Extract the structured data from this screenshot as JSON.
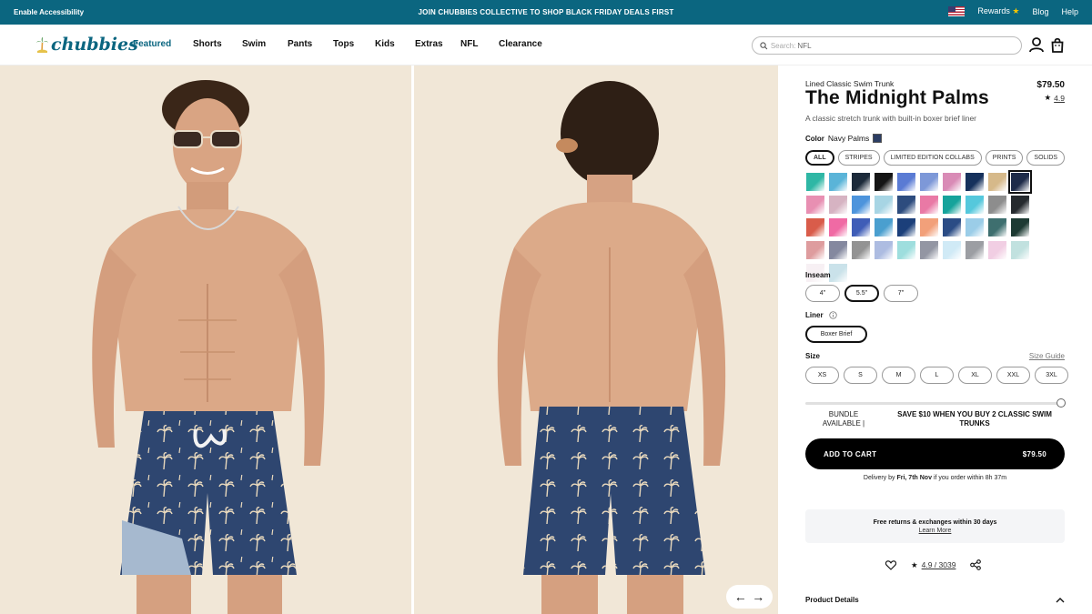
{
  "announcement": {
    "accessibility": "Enable Accessibility",
    "promo": "JOIN CHUBBIES COLLECTIVE TO SHOP BLACK FRIDAY DEALS FIRST",
    "rewards": "Rewards",
    "rewards_icon": "star-icon",
    "blog": "Blog",
    "help": "Help",
    "bg_color": "#0b6680"
  },
  "header": {
    "logo_text": "chubbies",
    "nav": [
      "Featured",
      "Shorts",
      "Swim",
      "Pants",
      "Tops",
      "Kids",
      "Extras",
      "NFL",
      "Clearance"
    ],
    "active_nav": "Featured",
    "search_label": "Search:",
    "search_value": "NFL",
    "icons": [
      "search-icon",
      "account-icon",
      "cart-icon"
    ]
  },
  "gallery": {
    "icons": [
      "arrow-left-icon",
      "arrow-right-icon"
    ],
    "prev": "←",
    "next": "→"
  },
  "product": {
    "subtitle": "Lined Classic Swim Trunk",
    "title": "The Midnight Palms",
    "price": "$79.50",
    "rating": "4.9",
    "description": "A classic stretch trunk with built-in boxer brief liner",
    "color_label": "Color",
    "color_value": "Navy Palms",
    "filters": [
      "ALL",
      "STRIPES",
      "LIMITED EDITION COLLABS",
      "PRINTS",
      "SOLIDS"
    ],
    "selected_filter": "ALL",
    "inseam_label": "Inseam",
    "inseams": [
      "4\"",
      "5.5\"",
      "7\""
    ],
    "selected_inseam": "5.5\"",
    "liner_label": "Liner",
    "liners": [
      "Boxer Brief"
    ],
    "selected_liner": "Boxer Brief",
    "size_label": "Size",
    "size_guide": "Size Guide",
    "sizes": [
      "XS",
      "S",
      "M",
      "L",
      "XL",
      "XXL",
      "3XL"
    ],
    "bundle_available": "BUNDLE AVAILABLE |",
    "bundle_offer": "SAVE $10 WHEN YOU BUY 2 CLASSIC SWIM TRUNKS",
    "add_to_cart": "ADD TO CART",
    "cart_price": "$79.50",
    "delivery_prefix": "Delivery by",
    "delivery_date": "Fri, 7th Nov",
    "delivery_suffix": "if you order within 8h 37m",
    "returns_title": "Free returns & exchanges within 30 days",
    "returns_link": "Learn More",
    "review_summary": "4.9 / 3039",
    "details_label": "Product Details",
    "icons": [
      "star-icon",
      "info-icon",
      "heart-icon",
      "share-icon",
      "chevron-up-icon"
    ]
  },
  "swatch_colors": [
    "#2fb7a5",
    "#5ab4d8",
    "#1c2a3a",
    "#151515",
    "#5a7bd4",
    "#7d98d8",
    "#d98bb6",
    "#16315c",
    "#d6b98a",
    "#1e2b49",
    "#e88fb2",
    "#d6b3c2",
    "#4d94dc",
    "#a7d5e4",
    "#2d4c7e",
    "#e979a5",
    "#16a39b",
    "#55c8dc",
    "#8d8d8d",
    "#262a2e",
    "#d95c4a",
    "#f06aa4",
    "#3f5db7",
    "#4a9fcf",
    "#1b3f7a",
    "#f2a07a",
    "#2b4c85",
    "#9bcde8",
    "#3e6f6f",
    "#1d3a33",
    "#c34c4f",
    "#1f2750",
    "#3a3a3a",
    "#6a86c9",
    "#4fc3c2",
    "#3b4158",
    "#a9d8ee",
    "#4a4f58",
    "#e6a6cc",
    "#8ec9c5",
    "#f0e4ea",
    "#9fcbd8"
  ],
  "selected_swatch": 9
}
